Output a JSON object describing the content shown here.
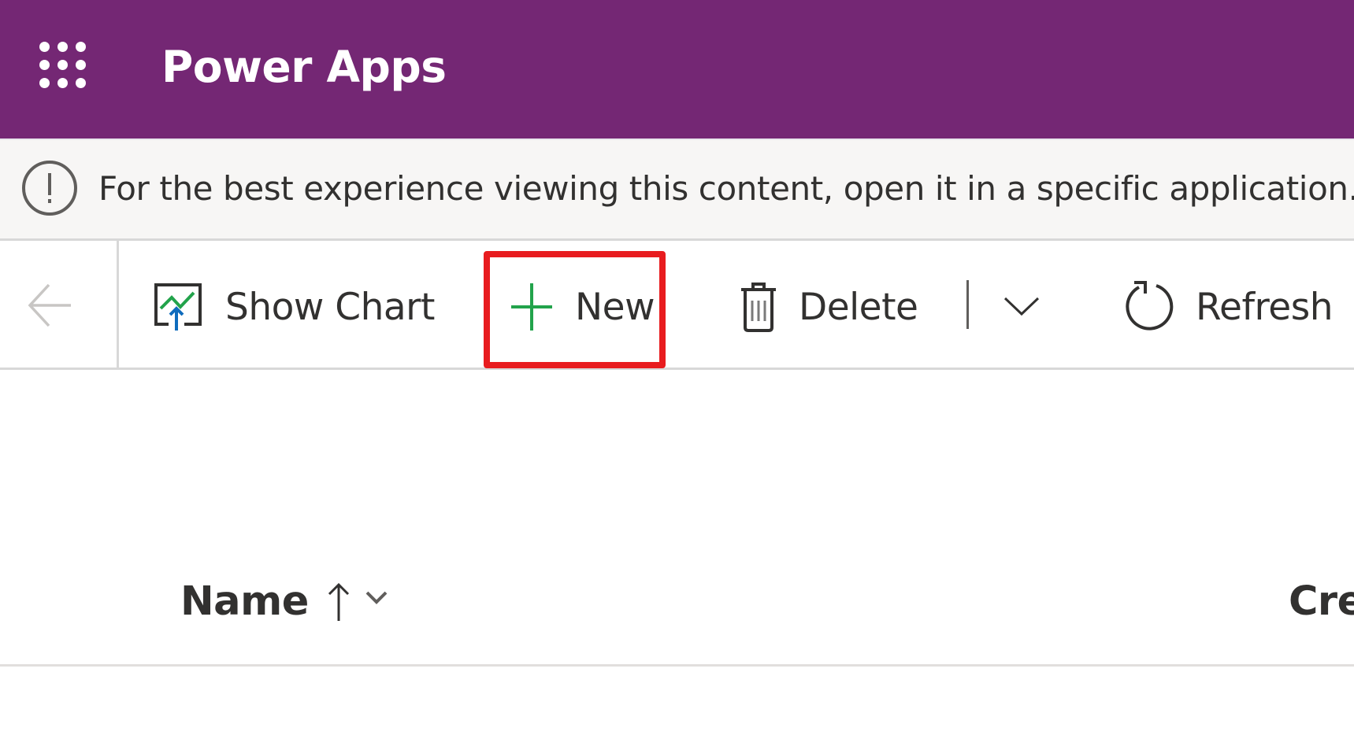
{
  "header": {
    "app_title": "Power Apps",
    "waffle_icon": "app-launcher-icon",
    "background_color": "#742774"
  },
  "info_bar": {
    "icon": "info-exclamation-icon",
    "message": "For the best experience viewing this content, open it in a specific application."
  },
  "toolbar": {
    "back_icon": "back-arrow-icon",
    "buttons": [
      {
        "label": "Show Chart",
        "icon": "show-chart-icon"
      },
      {
        "label": "New",
        "icon": "plus-icon",
        "highlighted": true
      },
      {
        "label": "Delete",
        "icon": "trash-icon"
      },
      {
        "label": "Refresh",
        "icon": "refresh-icon"
      }
    ],
    "more_icon": "chevron-down-icon",
    "highlight_color": "#e81c1f",
    "new_icon_color": "#22a34b"
  },
  "grid": {
    "columns": [
      {
        "label": "Name",
        "sort": "ascending",
        "sort_icon": "arrow-up-icon",
        "menu_icon": "chevron-down-icon"
      },
      {
        "label": "Cre"
      }
    ]
  }
}
